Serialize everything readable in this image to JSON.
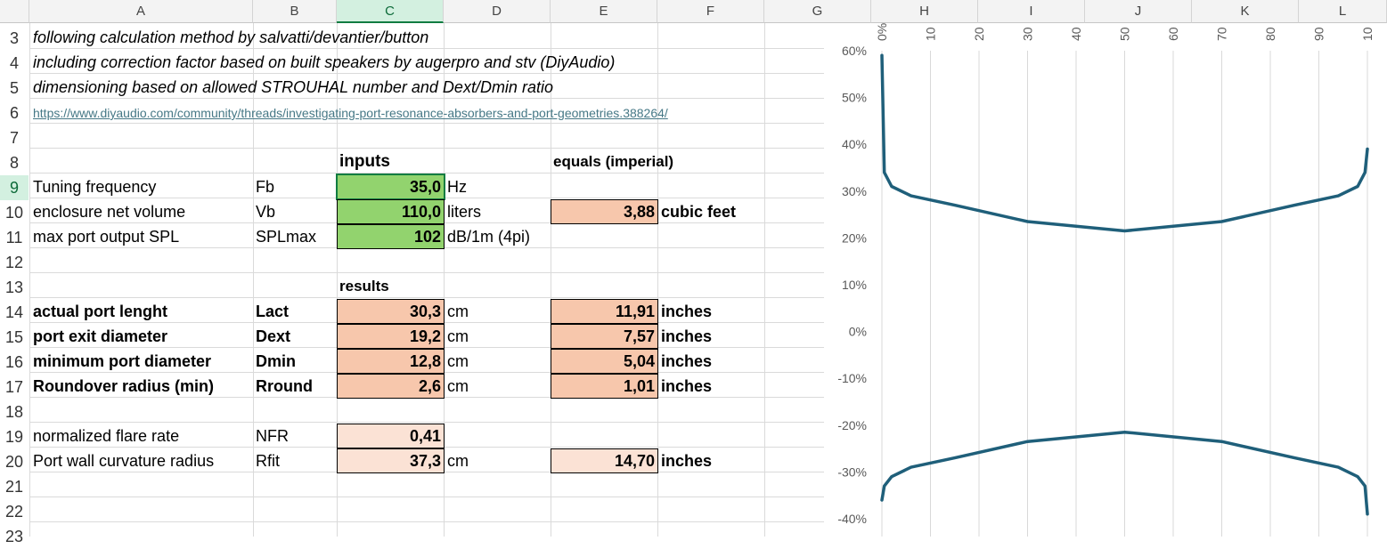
{
  "columns": [
    "A",
    "B",
    "C",
    "D",
    "E",
    "F",
    "G",
    "H",
    "I",
    "J",
    "K",
    "L"
  ],
  "rows": [
    "3",
    "4",
    "5",
    "6",
    "7",
    "8",
    "9",
    "10",
    "11",
    "12",
    "13",
    "14",
    "15",
    "16",
    "17",
    "18",
    "19",
    "20",
    "21",
    "22",
    "23"
  ],
  "notes": {
    "line1": "following calculation method by salvatti/devantier/button",
    "line2": "including correction factor based on built speakers by augerpro and stv (DiyAudio)",
    "line3": "dimensioning based on allowed STROUHAL number and Dext/Dmin ratio",
    "link": "https://www.diyaudio.com/community/threads/investigating-port-resonance-absorbers-and-port-geometries.388264/"
  },
  "headers": {
    "inputs": "inputs",
    "imperial": "equals (imperial)",
    "results": "results"
  },
  "inputs": [
    {
      "label": "Tuning frequency",
      "sym": "Fb",
      "value": "35,0",
      "unit": "Hz"
    },
    {
      "label": "enclosure net volume",
      "sym": "Vb",
      "value": "110,0",
      "unit": "liters",
      "imperial": "3,88",
      "imperial_unit": "cubic feet"
    },
    {
      "label": "max port output SPL",
      "sym": "SPLmax",
      "value": "102",
      "unit": "dB/1m (4pi)"
    }
  ],
  "results": [
    {
      "label": "actual port lenght",
      "sym": "Lact",
      "value": "30,3",
      "unit": "cm",
      "imperial": "11,91",
      "imperial_unit": "inches"
    },
    {
      "label": "port exit diameter",
      "sym": "Dext",
      "value": "19,2",
      "unit": "cm",
      "imperial": "7,57",
      "imperial_unit": "inches"
    },
    {
      "label": "minimum port diameter",
      "sym": "Dmin",
      "value": "12,8",
      "unit": "cm",
      "imperial": "5,04",
      "imperial_unit": "inches"
    },
    {
      "label": "Roundover radius (min)",
      "sym": "Rround",
      "value": "2,6",
      "unit": "cm",
      "imperial": "1,01",
      "imperial_unit": "inches"
    }
  ],
  "extra": [
    {
      "label": "normalized flare rate",
      "sym": "NFR",
      "value": "0,41"
    },
    {
      "label": "Port wall curvature radius",
      "sym": "Rfit",
      "value": "37,3",
      "unit": "cm",
      "imperial": "14,70",
      "imperial_unit": "inches"
    }
  ],
  "chart_data": {
    "type": "line",
    "y_ticks": [
      "60%",
      "50%",
      "40%",
      "30%",
      "20%",
      "10%",
      "0%",
      "-10%",
      "-20%",
      "-30%",
      "-40%"
    ],
    "x_ticks": [
      "0%",
      "10",
      "20",
      "30",
      "40",
      "50",
      "60",
      "70",
      "80",
      "90",
      "10"
    ],
    "ylim": [
      -0.4,
      0.6
    ],
    "xlim": [
      0,
      1
    ],
    "line_color": "#1f5f7a",
    "series": [
      {
        "x": [
          0,
          0.005,
          0.02,
          0.06,
          0.15,
          0.3,
          0.5,
          0.7,
          0.85,
          0.94,
          0.98,
          0.995,
          1
        ],
        "y": [
          0.59,
          0.34,
          0.31,
          0.29,
          0.27,
          0.235,
          0.215,
          0.235,
          0.27,
          0.29,
          0.31,
          0.34,
          0.39
        ]
      },
      {
        "x": [
          0,
          0.005,
          0.02,
          0.06,
          0.15,
          0.3,
          0.5,
          0.7,
          0.85,
          0.94,
          0.98,
          0.995,
          1
        ],
        "y": [
          -0.36,
          -0.33,
          -0.31,
          -0.29,
          -0.27,
          -0.235,
          -0.215,
          -0.235,
          -0.27,
          -0.29,
          -0.31,
          -0.33,
          -0.39
        ]
      }
    ]
  }
}
